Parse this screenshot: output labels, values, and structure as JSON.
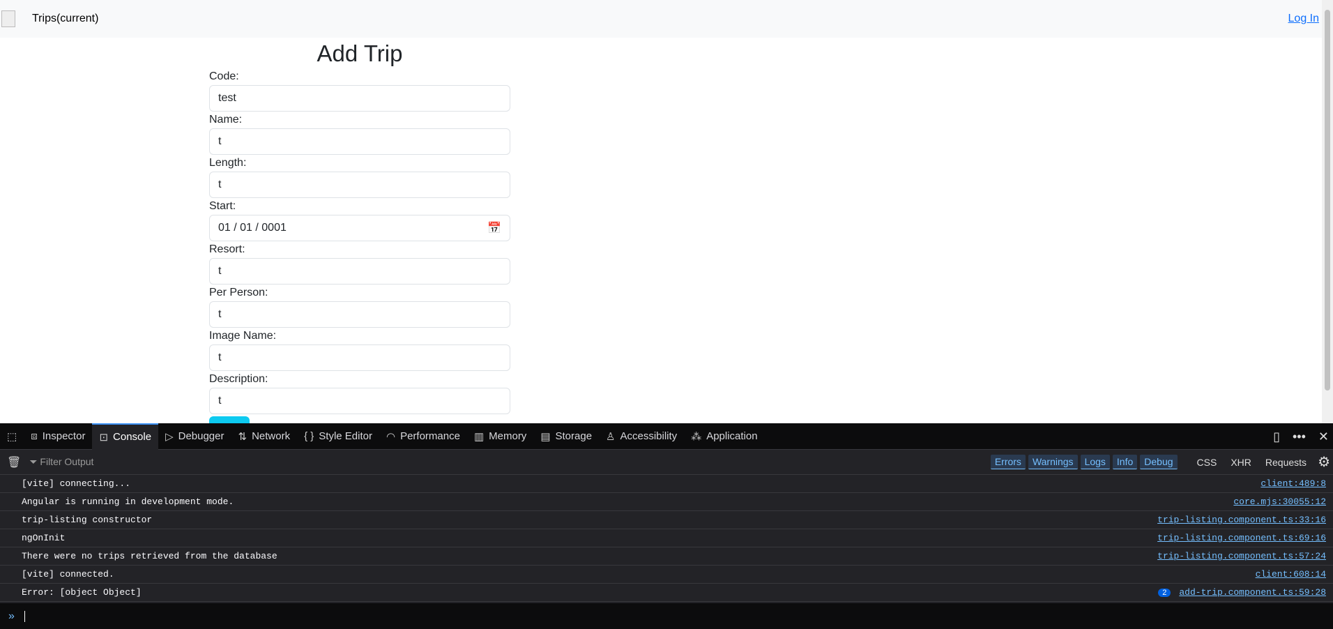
{
  "navbar": {
    "brand": "Trips(current)",
    "login": "Log In"
  },
  "form": {
    "title": "Add Trip",
    "fields": [
      {
        "label": "Code:",
        "value": "test"
      },
      {
        "label": "Name:",
        "value": "t"
      },
      {
        "label": "Length:",
        "value": "t"
      },
      {
        "label": "Start:",
        "value": "01 / 01 / 0001"
      },
      {
        "label": "Resort:",
        "value": "t"
      },
      {
        "label": "Per Person:",
        "value": "t"
      },
      {
        "label": "Image Name:",
        "value": "t"
      },
      {
        "label": "Description:",
        "value": "t"
      }
    ]
  },
  "devtools": {
    "tabs": [
      "Inspector",
      "Console",
      "Debugger",
      "Network",
      "Style Editor",
      "Performance",
      "Memory",
      "Storage",
      "Accessibility",
      "Application"
    ],
    "filter_placeholder": "Filter Output",
    "filters": [
      "Errors",
      "Warnings",
      "Logs",
      "Info",
      "Debug"
    ],
    "extra_filters": [
      "CSS",
      "XHR",
      "Requests"
    ],
    "messages": [
      {
        "text": "[vite] connecting...",
        "source": "client:489:8"
      },
      {
        "text": "Angular is running in development mode.",
        "source": "core.mjs:30055:12"
      },
      {
        "text": "trip-listing constructor",
        "source": "trip-listing.component.ts:33:16"
      },
      {
        "text": "ngOnInit",
        "source": "trip-listing.component.ts:69:16"
      },
      {
        "text": "There were no trips retrieved from the database",
        "source": "trip-listing.component.ts:57:24"
      },
      {
        "text": "[vite] connected.",
        "source": "client:608:14"
      },
      {
        "text": "Error: [object Object]",
        "source": "add-trip.component.ts:59:28",
        "count": "2"
      }
    ],
    "accent": "#3b90f4"
  }
}
